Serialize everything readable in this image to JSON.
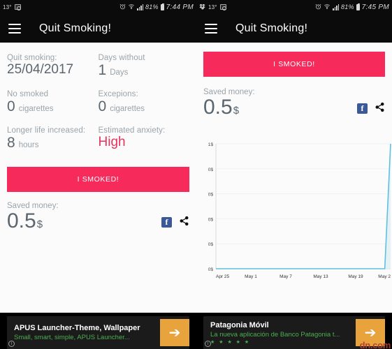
{
  "left": {
    "statusbar": {
      "temp": "13°",
      "left_icons": [
        "photo-icon"
      ],
      "alarm_icon": "alarm-icon",
      "wifi_icon": "wifi-icon",
      "signal_icon": "signal-icon",
      "battery_pct": "81%",
      "battery_icon": "battery-icon",
      "time": "7:44 PM"
    },
    "appbar": {
      "menu_icon": "hamburger-menu-icon",
      "title": "Quit Smoking!"
    },
    "stats": [
      {
        "label": "Quit smoking:",
        "value": "25/04/2017",
        "unit": ""
      },
      {
        "label": "Days without",
        "value": "1",
        "unit": "Days"
      },
      {
        "label": "No smoked",
        "value": "0",
        "unit": "cigarettes"
      },
      {
        "label": "Excepions:",
        "value": "0",
        "unit": "cigarettes"
      },
      {
        "label": "Longer life increased:",
        "value": "8",
        "unit": "hours"
      },
      {
        "label": "Estimated anxiety:",
        "value": "High",
        "unit": ""
      }
    ],
    "smoked_button": "I SMOKED!",
    "saved": {
      "label": "Saved money:",
      "value": "0.5",
      "currency": "$"
    },
    "social": {
      "facebook_icon": "facebook-icon",
      "facebook_letter": "f",
      "share_icon": "share-icon"
    },
    "ad": {
      "title": "APUS Launcher-Theme, Wallpaper",
      "subtitle": "Small, smart, simple, APUS Launcher...",
      "stars": "",
      "cta_icon": "arrow-right-icon",
      "info_icon": "info-icon",
      "info_letter": "i"
    }
  },
  "right": {
    "statusbar": {
      "dropbox_icon": "dropbox-icon",
      "temp": "13°",
      "left_icons": [
        "photo-icon"
      ],
      "alarm_icon": "alarm-icon",
      "wifi_icon": "wifi-icon",
      "signal_icon": "signal-icon",
      "battery_pct": "81%",
      "battery_icon": "battery-icon",
      "time": "7:45 PM"
    },
    "appbar": {
      "menu_icon": "hamburger-menu-icon",
      "title": "Quit Smoking!"
    },
    "smoked_button": "I SMOKED!",
    "saved": {
      "label": "Saved money:",
      "value": "0.5",
      "currency": "$"
    },
    "social": {
      "facebook_icon": "facebook-icon",
      "facebook_letter": "f",
      "share_icon": "share-icon"
    },
    "ad": {
      "title": "Patagonia Móvil",
      "subtitle": "La nueva aplicación de Banco Patagonia t...",
      "stars": "★ ★ ★ ★ ★",
      "cta_icon": "arrow-right-icon",
      "info_icon": "info-icon",
      "info_letter": "i",
      "watermark": "dn.com"
    }
  },
  "colors": {
    "accent_pink": "#f62a5b",
    "chart_line": "#5ec0de",
    "chart_fill": "#e8f6fb",
    "text_muted": "#9aa3ab",
    "text_dark": "#5c666f",
    "facebook_blue": "#3b5998",
    "ad_green": "#4caf50",
    "ad_orange": "#e8a33d"
  },
  "chart_data": {
    "type": "area",
    "title": "",
    "xlabel": "",
    "ylabel": "",
    "x": [
      "Apr 25",
      "May 1",
      "May 7",
      "May 13",
      "May 19",
      "May 2"
    ],
    "xtick_labels": [
      "Apr 25",
      "May 1",
      "May 7",
      "May 13",
      "May 19",
      "May 2"
    ],
    "ytick_labels": [
      "1$",
      "0$",
      "0$",
      "0$",
      "0$",
      "0$"
    ],
    "ylim": [
      0,
      0.5
    ],
    "grid": true,
    "legend": "none",
    "series": [
      {
        "name": "Saved money",
        "values": [
          0,
          0,
          0,
          0,
          0,
          0,
          0,
          0,
          0,
          0,
          0,
          0,
          0,
          0,
          0,
          0,
          0,
          0,
          0,
          0,
          0,
          0,
          0,
          0,
          0,
          0,
          0,
          0,
          0,
          0,
          0.5
        ]
      }
    ],
    "annotations": "Flat at 0$ from Apr 25 until the final day, then a sharp vertical rise to 0.5$ at May 25."
  }
}
